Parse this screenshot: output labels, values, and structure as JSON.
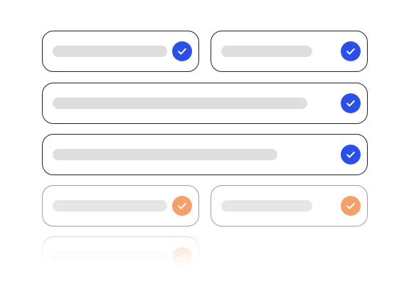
{
  "fields": [
    {
      "id": "f1",
      "state": "verified",
      "value": ""
    },
    {
      "id": "f2",
      "state": "verified",
      "value": ""
    },
    {
      "id": "f3",
      "state": "verified",
      "value": ""
    },
    {
      "id": "f4",
      "state": "verified",
      "value": ""
    },
    {
      "id": "f5",
      "state": "pending",
      "value": ""
    },
    {
      "id": "f6",
      "state": "pending",
      "value": ""
    },
    {
      "id": "f7",
      "state": "pending",
      "value": ""
    }
  ],
  "icons": {
    "verified": "check-circle-icon",
    "pending": "check-circle-icon"
  },
  "colors": {
    "verified": "#2b50e8",
    "pending": "#f4a06a",
    "placeholder_bar": "#dcdee0",
    "border": "#1f2328",
    "muted_border": "#9aa0a6"
  }
}
